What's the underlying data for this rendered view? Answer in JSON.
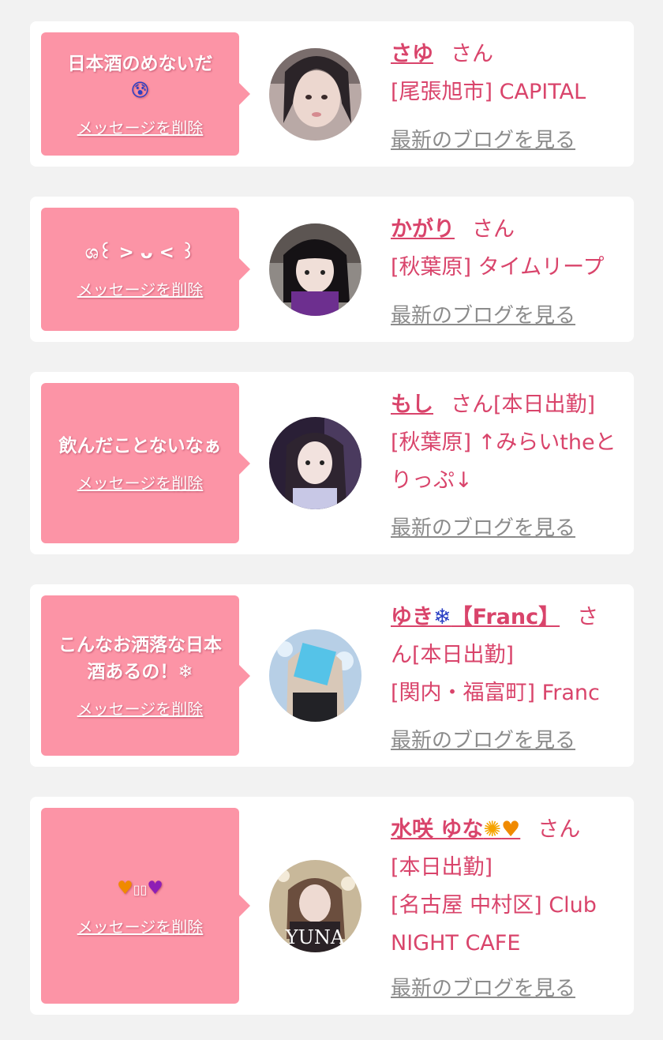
{
  "delete_label": "メッセージを削除",
  "blog_label": "最新のブログを見る",
  "san_label": "さん",
  "colors": {
    "page_bg": "#f2f2f2",
    "bubble_bg": "#fc94a6",
    "accent": "#d9446b",
    "link_gray": "#8b8b8b"
  },
  "cards": [
    {
      "message": "日本酒のめないだ",
      "message_emoji": "😰",
      "name": "さゆ",
      "status": "",
      "shop": "[尾張旭市] CAPITAL"
    },
    {
      "message": "ශ꒰ > ᴗ < ꒱",
      "name": "かがり",
      "status": "",
      "shop": "[秋葉原] タイムリープ"
    },
    {
      "message": "飲んだことないなぁ",
      "name": "もし",
      "status": "[本日出勤]",
      "shop": "[秋葉原] ↑みらいtheとりっぷ↓"
    },
    {
      "message": "こんなお洒落な日本酒あるの！",
      "message_emoji": "❄",
      "name": "ゆき",
      "name_emoji": "❄",
      "name_suffix": "【Franc】",
      "status": "[本日出勤]",
      "shop": "[関内・福富町] Franc"
    },
    {
      "message_emoji_left": "♥",
      "message_boxes": "▯▯",
      "message_emoji_right": "♥",
      "name": "水咲 ゆな",
      "name_emoji_1": "✺",
      "name_emoji_2": "♥",
      "status": "[本日出勤]",
      "shop": "[名古屋 中村区] Club NIGHT CAFE",
      "avatar_text": "YUNA"
    }
  ]
}
